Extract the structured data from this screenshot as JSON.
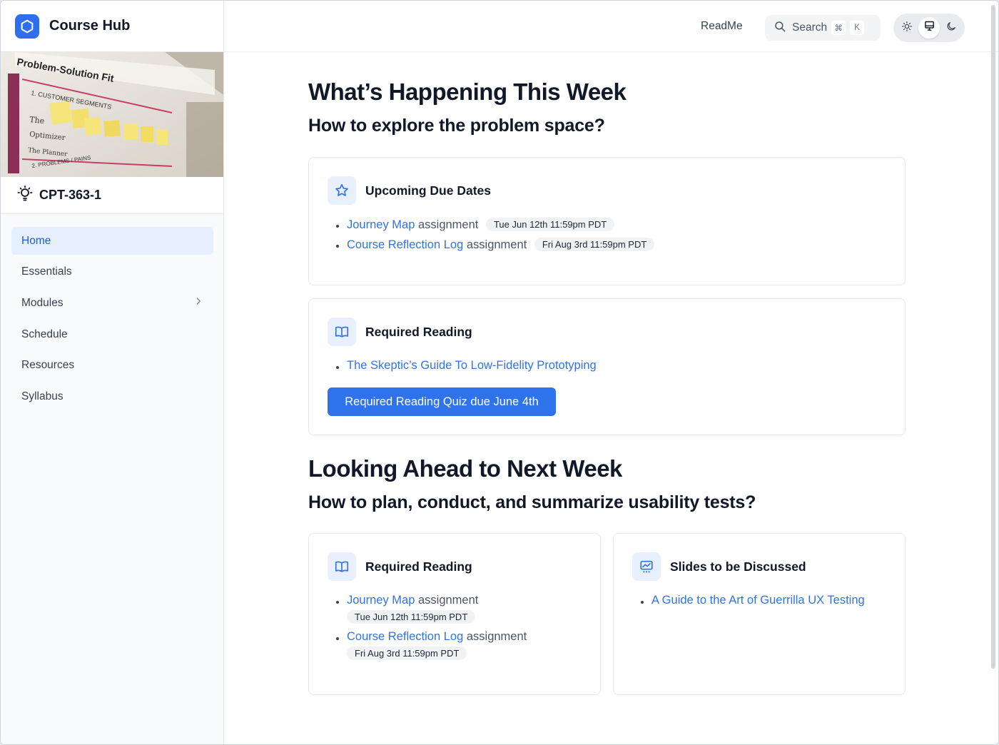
{
  "app": {
    "name": "Course Hub"
  },
  "course": {
    "id": "CPT-363-1"
  },
  "sidebar": {
    "items": [
      {
        "label": "Home",
        "active": true
      },
      {
        "label": "Essentials"
      },
      {
        "label": "Modules",
        "has_children": true
      },
      {
        "label": "Schedule"
      },
      {
        "label": "Resources"
      },
      {
        "label": "Syllabus"
      }
    ]
  },
  "topbar": {
    "readme": "ReadMe",
    "search": {
      "label": "Search",
      "shortcut_mod": "⌘",
      "shortcut_key": "K"
    },
    "theme": {
      "options": [
        "light",
        "system",
        "dark"
      ],
      "selected": "system"
    }
  },
  "this_week": {
    "title": "What’s Happening This Week",
    "subtitle": "How to explore the problem space?",
    "due_dates": {
      "title": "Upcoming Due Dates",
      "items": [
        {
          "link": "Journey Map",
          "suffix": "assignment",
          "date": "Tue Jun 12th 11:59pm PDT"
        },
        {
          "link": "Course Reflection Log",
          "suffix": "assignment",
          "date": "Fri Aug 3rd 11:59pm PDT"
        }
      ]
    },
    "reading": {
      "title": "Required Reading",
      "items": [
        {
          "link": "The Skeptic’s Guide To Low-Fidelity Prototyping"
        }
      ],
      "quiz_button": "Required Reading Quiz due June 4th"
    }
  },
  "next_week": {
    "title": "Looking Ahead to Next Week",
    "subtitle": "How to plan, conduct, and summarize usability tests?",
    "reading": {
      "title": "Required Reading",
      "items": [
        {
          "link": "Journey Map",
          "suffix": "assignment",
          "date": "Tue Jun 12th 11:59pm PDT"
        },
        {
          "link": "Course Reflection Log",
          "suffix": "assignment",
          "date": "Fri Aug 3rd 11:59pm PDT"
        }
      ]
    },
    "slides": {
      "title": "Slides to be Discussed",
      "items": [
        {
          "link": "A Guide to the Art of Guerrilla UX Testing"
        }
      ]
    }
  },
  "colors": {
    "accent": "#2f73ec",
    "link": "#2f73e6",
    "nav_active_bg": "#e6efff",
    "icon_bg": "#e8f0fe"
  }
}
